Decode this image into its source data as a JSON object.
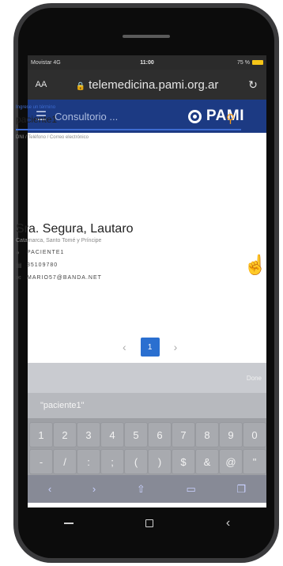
{
  "status": {
    "carrier": "Movistar 4G",
    "time": "11:00",
    "battery": "75 %"
  },
  "urlbar": {
    "aa": "AA",
    "url": "telemedicina.pami.org.ar"
  },
  "appbar": {
    "title": "Consultorio ...",
    "logo": "PAMI"
  },
  "search": {
    "label": "Ingrese un término",
    "value": "paciente1",
    "hint": "DNI / Teléfono / Correo electrónico"
  },
  "patient": {
    "name": "Sra. Segura, Lautaro",
    "location": "Catamarca, Santo Tomé y Príncipe",
    "username": "PACIENTE1",
    "phone": "35109780",
    "email": "MARIO57@BANDA.NET"
  },
  "pagination": {
    "current": "1"
  },
  "keyboard": {
    "done_label": "Done",
    "suggestion": "\"paciente1\"",
    "row1": [
      "1",
      "2",
      "3",
      "4",
      "5",
      "6",
      "7",
      "8",
      "9",
      "0"
    ],
    "row2": [
      "-",
      "/",
      ":",
      ";",
      "(",
      ")",
      "$",
      "&",
      "@",
      "\""
    ]
  }
}
